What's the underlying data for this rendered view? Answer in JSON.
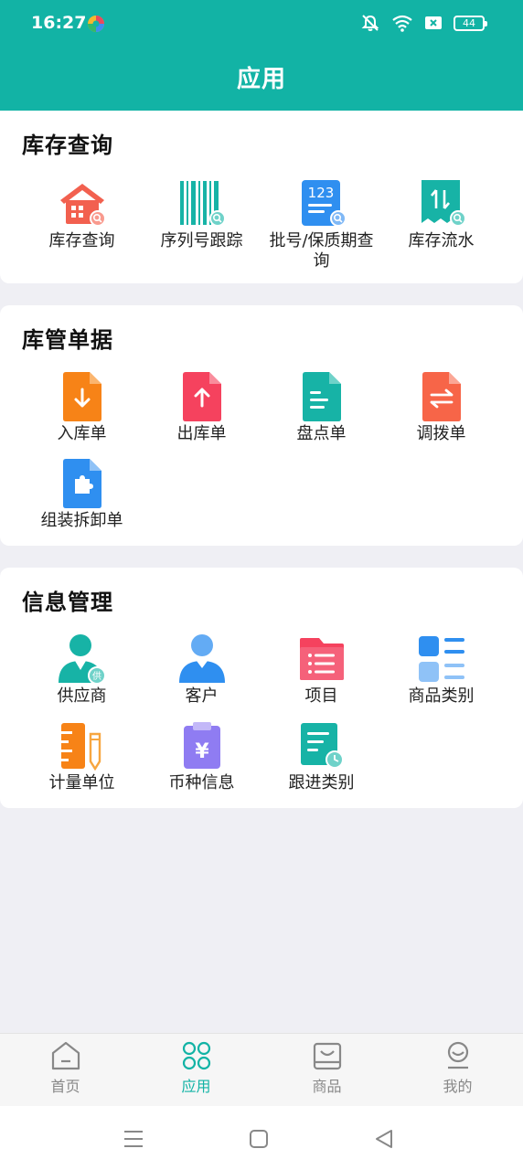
{
  "status_bar": {
    "time": "16:27",
    "battery": "44"
  },
  "header": {
    "title": "应用"
  },
  "sections": [
    {
      "title": "库存查询",
      "items": [
        {
          "label": "库存查询",
          "icon": "warehouse-search-icon"
        },
        {
          "label": "序列号跟踪",
          "icon": "barcode-search-icon"
        },
        {
          "label": "批号/保质期查询",
          "icon": "batch-number-search-icon"
        },
        {
          "label": "库存流水",
          "icon": "stock-flow-icon"
        }
      ]
    },
    {
      "title": "库管单据",
      "items": [
        {
          "label": "入库单",
          "icon": "inbound-doc-icon"
        },
        {
          "label": "出库单",
          "icon": "outbound-doc-icon"
        },
        {
          "label": "盘点单",
          "icon": "stocktake-doc-icon"
        },
        {
          "label": "调拨单",
          "icon": "transfer-doc-icon"
        },
        {
          "label": "组装拆卸单",
          "icon": "assembly-doc-icon"
        }
      ]
    },
    {
      "title": "信息管理",
      "items": [
        {
          "label": "供应商",
          "icon": "supplier-icon",
          "badge": "供"
        },
        {
          "label": "客户",
          "icon": "customer-icon"
        },
        {
          "label": "项目",
          "icon": "project-folder-icon"
        },
        {
          "label": "商品类别",
          "icon": "category-grid-icon"
        },
        {
          "label": "计量单位",
          "icon": "unit-ruler-icon"
        },
        {
          "label": "币种信息",
          "icon": "currency-clipboard-icon",
          "symbol": "¥"
        },
        {
          "label": "跟进类别",
          "icon": "follow-up-doc-icon"
        }
      ]
    }
  ],
  "tabbar": [
    {
      "label": "首页",
      "icon": "home-icon",
      "active": false
    },
    {
      "label": "应用",
      "icon": "apps-icon",
      "active": true
    },
    {
      "label": "商品",
      "icon": "goods-bag-icon",
      "active": false
    },
    {
      "label": "我的",
      "icon": "profile-icon",
      "active": false
    }
  ],
  "colors": {
    "accent": "#12b3a5",
    "orange_red": "#f2604f",
    "teal": "#17b3a6",
    "blue": "#2f8ff0",
    "orange": "#f78317",
    "red": "#f5425e",
    "coral": "#f76548",
    "purple": "#8f7cf2"
  }
}
